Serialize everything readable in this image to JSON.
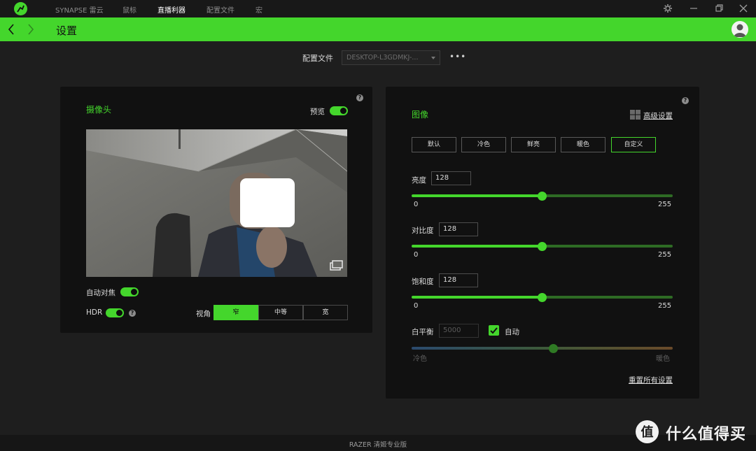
{
  "nav": {
    "tabs": [
      {
        "label": "SYNAPSE 雷云",
        "active": false
      },
      {
        "label": "鼠标",
        "active": false
      },
      {
        "label": "直播利器",
        "active": true
      },
      {
        "label": "配置文件",
        "active": false
      },
      {
        "label": "宏",
        "active": false
      }
    ]
  },
  "header": {
    "title": "设置"
  },
  "profile": {
    "label": "配置文件",
    "value": "DESKTOP-L3GDMKJ-...",
    "more": "•••"
  },
  "camera": {
    "title": "摄像头",
    "preview_label": "预览",
    "preview_on": true,
    "autofocus_label": "自动对焦",
    "autofocus_on": true,
    "hdr_label": "HDR",
    "hdr_on": true,
    "fov_label": "视角",
    "fov_options": [
      "窄",
      "中等",
      "宽"
    ],
    "fov_selected": "窄"
  },
  "image": {
    "title": "图像",
    "advanced_link": "高级设置",
    "presets": [
      "默认",
      "冷色",
      "鲜亮",
      "暖色",
      "自定义"
    ],
    "preset_selected": "自定义",
    "sliders": [
      {
        "label": "亮度",
        "value": "128",
        "min": "0",
        "max": "255"
      },
      {
        "label": "对比度",
        "value": "128",
        "min": "0",
        "max": "255"
      },
      {
        "label": "饱和度",
        "value": "128",
        "min": "0",
        "max": "255"
      }
    ],
    "white_balance": {
      "label": "白平衡",
      "value": "5000",
      "auto_label": "自动",
      "auto_checked": true,
      "min_label": "冷色",
      "max_label": "暖色",
      "level": 0.54
    },
    "reset_link": "重置所有设置"
  },
  "footer": {
    "text": "RAZER 清姬专业版"
  },
  "watermark": {
    "text": "什么值得买"
  },
  "colors": {
    "accent": "#44d62c",
    "panel": "#111111",
    "background": "#1e1e1e"
  }
}
